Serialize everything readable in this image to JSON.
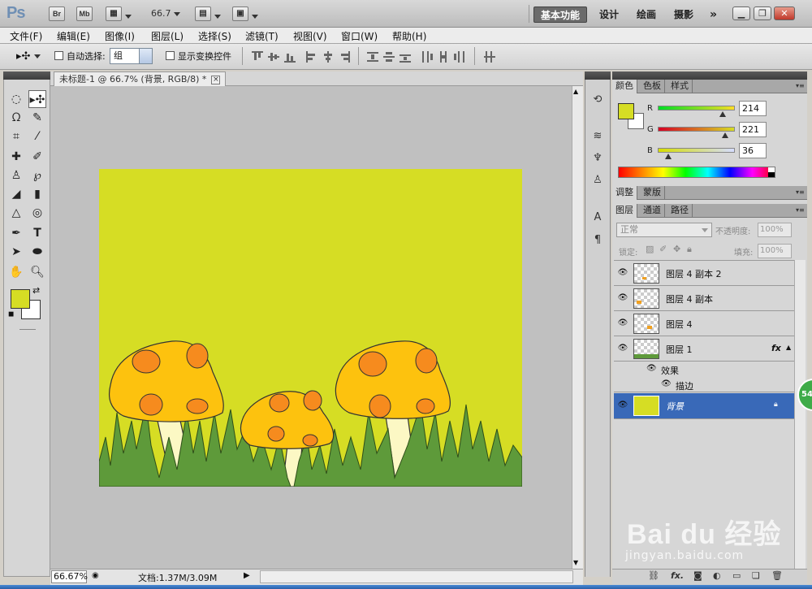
{
  "appbar": {
    "logo": "Ps",
    "bridge": "Br",
    "minibridge": "Mb",
    "zoom": "66.7",
    "workspaces": {
      "active": "基本功能",
      "design": "设计",
      "painting": "绘画",
      "photography": "摄影"
    },
    "more": "»"
  },
  "menu": [
    "文件(F)",
    "编辑(E)",
    "图像(I)",
    "图层(L)",
    "选择(S)",
    "滤镜(T)",
    "视图(V)",
    "窗口(W)",
    "帮助(H)"
  ],
  "options": {
    "auto_select_label": "自动选择:",
    "auto_select_value": "组",
    "show_transform_label": "显示变换控件"
  },
  "document": {
    "tab_title": "未标题-1 @ 66.7% (背景, RGB/8) *",
    "close": "×",
    "canvas_color": "#d6dd24"
  },
  "status": {
    "zoom": "66.67%",
    "doc_size": "文档:1.37M/3.09M"
  },
  "color_panel": {
    "tabs": [
      "颜色",
      "色板",
      "样式"
    ],
    "r_label": "R",
    "g_label": "G",
    "b_label": "B",
    "r": "214",
    "g": "221",
    "b": "36",
    "r_frac": 0.84,
    "g_frac": 0.87,
    "b_frac": 0.14,
    "fg_color": "#d6dd24"
  },
  "adjust_panel": {
    "tabs": [
      "调整",
      "蒙版"
    ]
  },
  "layers_panel": {
    "tabs": [
      "图层",
      "通道",
      "路径"
    ],
    "blend_mode": "正常",
    "opacity_label": "不透明度:",
    "opacity": "100%",
    "lock_label": "锁定:",
    "fill_label": "填充:",
    "fill": "100%",
    "layers": [
      {
        "name": "图层 4 副本 2"
      },
      {
        "name": "图层 4 副本"
      },
      {
        "name": "图层 4"
      },
      {
        "name": "图层 1",
        "fx": "fx"
      }
    ],
    "effects_label": "效果",
    "stroke_label": "描边",
    "background": "背景",
    "fx_label": "fx"
  },
  "watermark": {
    "logo": "Bai du 经验",
    "url": "jingyan.baidu.com"
  },
  "badge": "54"
}
